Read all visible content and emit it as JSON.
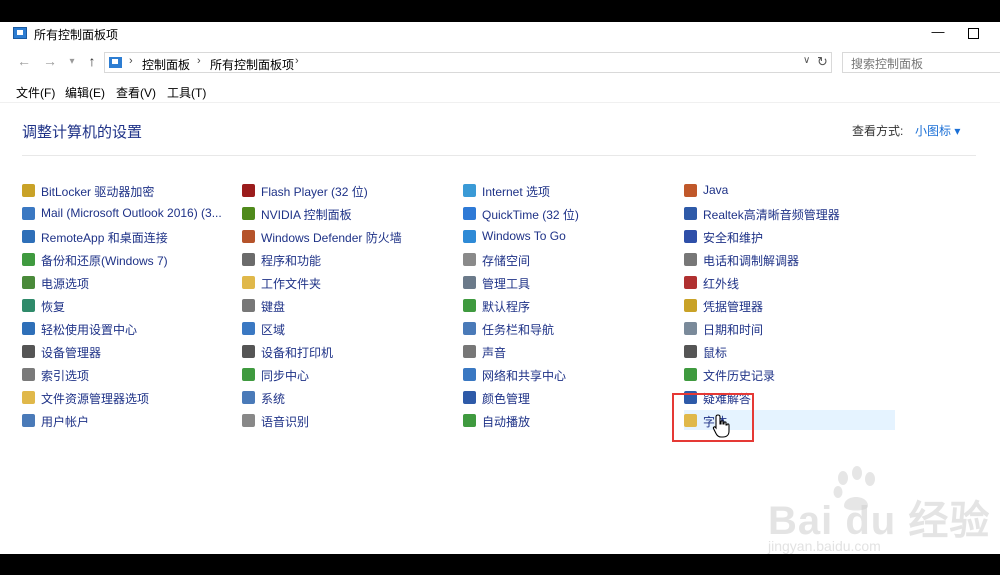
{
  "window": {
    "title": "所有控制面板项",
    "minimize": "—"
  },
  "nav": {
    "back": "←",
    "forward": "→",
    "up": "↑"
  },
  "address": {
    "separator": "›",
    "crumbs": [
      "控制面板",
      "所有控制面板项"
    ],
    "dropdown": "∨",
    "refresh": "↻"
  },
  "search": {
    "placeholder": "搜索控制面板"
  },
  "menu": [
    "文件(F)",
    "编辑(E)",
    "查看(V)",
    "工具(T)"
  ],
  "header": {
    "title": "调整计算机的设置",
    "view_by": "查看方式:",
    "view_mode": "小图标 ▾"
  },
  "columns": [
    [
      {
        "label": "BitLocker 驱动器加密",
        "icon": "bitlocker-icon",
        "color": "#c9a227"
      },
      {
        "label": "Mail (Microsoft Outlook 2016) (3...",
        "icon": "mail-icon",
        "color": "#3a78c2"
      },
      {
        "label": "RemoteApp 和桌面连接",
        "icon": "remoteapp-icon",
        "color": "#2e6fb8"
      },
      {
        "label": "备份和还原(Windows 7)",
        "icon": "backup-icon",
        "color": "#3f9a3f"
      },
      {
        "label": "电源选项",
        "icon": "power-icon",
        "color": "#4a8a3a"
      },
      {
        "label": "恢复",
        "icon": "recovery-icon",
        "color": "#2f8a6a"
      },
      {
        "label": "轻松使用设置中心",
        "icon": "ease-of-access-icon",
        "color": "#2e6fb8"
      },
      {
        "label": "设备管理器",
        "icon": "device-manager-icon",
        "color": "#555555"
      },
      {
        "label": "索引选项",
        "icon": "indexing-icon",
        "color": "#7a7a7a"
      },
      {
        "label": "文件资源管理器选项",
        "icon": "folder-options-icon",
        "color": "#e0b84a"
      },
      {
        "label": "用户帐户",
        "icon": "user-accounts-icon",
        "color": "#4a7ab8"
      }
    ],
    [
      {
        "label": "Flash Player (32 位)",
        "icon": "flash-icon",
        "color": "#9b1c1c"
      },
      {
        "label": "NVIDIA 控制面板",
        "icon": "nvidia-icon",
        "color": "#4f8a1b"
      },
      {
        "label": "Windows Defender 防火墙",
        "icon": "firewall-icon",
        "color": "#b5532a"
      },
      {
        "label": "程序和功能",
        "icon": "programs-icon",
        "color": "#6b6b6b"
      },
      {
        "label": "工作文件夹",
        "icon": "work-folders-icon",
        "color": "#e0b84a"
      },
      {
        "label": "键盘",
        "icon": "keyboard-icon",
        "color": "#777777"
      },
      {
        "label": "区域",
        "icon": "region-icon",
        "color": "#3a78c2"
      },
      {
        "label": "设备和打印机",
        "icon": "printer-icon",
        "color": "#555555"
      },
      {
        "label": "同步中心",
        "icon": "sync-icon",
        "color": "#3f9a3f"
      },
      {
        "label": "系统",
        "icon": "system-icon",
        "color": "#4a7ab8"
      },
      {
        "label": "语音识别",
        "icon": "microphone-icon",
        "color": "#888888"
      }
    ],
    [
      {
        "label": "Internet 选项",
        "icon": "internet-icon",
        "color": "#3a9ad6"
      },
      {
        "label": "QuickTime (32 位)",
        "icon": "quicktime-icon",
        "color": "#2e7ad6"
      },
      {
        "label": "Windows To Go",
        "icon": "windows-to-go-icon",
        "color": "#2e8ad6"
      },
      {
        "label": "存储空间",
        "icon": "storage-icon",
        "color": "#8a8a8a"
      },
      {
        "label": "管理工具",
        "icon": "admin-tools-icon",
        "color": "#6b7a8a"
      },
      {
        "label": "默认程序",
        "icon": "default-programs-icon",
        "color": "#3f9a3f"
      },
      {
        "label": "任务栏和导航",
        "icon": "taskbar-icon",
        "color": "#4a7ab8"
      },
      {
        "label": "声音",
        "icon": "sound-icon",
        "color": "#777777"
      },
      {
        "label": "网络和共享中心",
        "icon": "network-icon",
        "color": "#3a78c2"
      },
      {
        "label": "颜色管理",
        "icon": "color-management-icon",
        "color": "#2e5aa8"
      },
      {
        "label": "自动播放",
        "icon": "autoplay-icon",
        "color": "#3f9a3f"
      }
    ],
    [
      {
        "label": "Java",
        "icon": "java-icon",
        "color": "#c0582a"
      },
      {
        "label": "Realtek高清晰音频管理器",
        "icon": "realtek-icon",
        "color": "#2e5aa8"
      },
      {
        "label": "安全和维护",
        "icon": "security-flag-icon",
        "color": "#2e4fa8"
      },
      {
        "label": "电话和调制解调器",
        "icon": "phone-modem-icon",
        "color": "#777777"
      },
      {
        "label": "红外线",
        "icon": "infrared-icon",
        "color": "#b03030"
      },
      {
        "label": "凭据管理器",
        "icon": "credential-icon",
        "color": "#c9a227"
      },
      {
        "label": "日期和时间",
        "icon": "clock-icon",
        "color": "#7a8a9a"
      },
      {
        "label": "鼠标",
        "icon": "mouse-icon",
        "color": "#555555"
      },
      {
        "label": "文件历史记录",
        "icon": "file-history-icon",
        "color": "#3f9a3f"
      },
      {
        "label": "疑难解答",
        "icon": "troubleshoot-icon",
        "color": "#2e5aa8"
      },
      {
        "label": "字体",
        "icon": "fonts-icon",
        "color": "#e0b84a"
      }
    ]
  ],
  "watermark": {
    "text": "Bai du 经验",
    "sub": "jingyan.baidu.com"
  }
}
